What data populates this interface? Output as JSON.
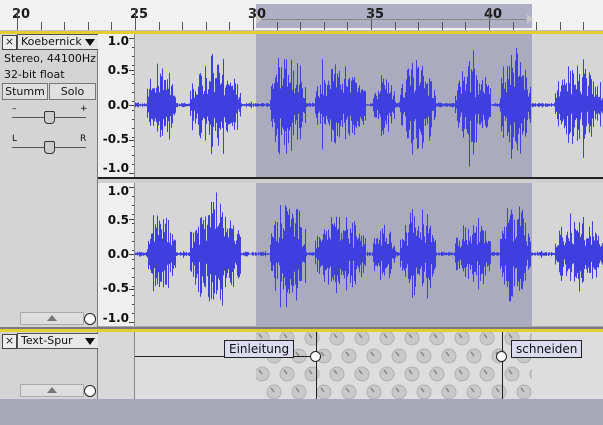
{
  "ruler": {
    "ticks": [
      "20",
      "25",
      "30",
      "35",
      "40"
    ]
  },
  "audio_track": {
    "name": "Koebernick",
    "info_format": "Stereo, 44100Hz",
    "info_bits": "32-bit float",
    "mute_label": "Stumm",
    "solo_label": "Solo",
    "gain_minus": "–",
    "gain_plus": "+",
    "pan_left": "L",
    "pan_right": "R",
    "scale_labels": [
      "1.0",
      "0.5",
      "0.0",
      "-0.5",
      "-1.0"
    ],
    "wave_color": "#3f3fdf"
  },
  "label_track": {
    "name": "Text-Spur",
    "labels": [
      "Einleitung",
      "schneiden"
    ]
  },
  "colors": {
    "selection": "#ababbf",
    "track_border": "#e4cf32",
    "background": "#d6d6d6"
  },
  "icons": {
    "close": "×",
    "dropdown": "chevron-down-icon",
    "sync": "clock-icon",
    "collapse": "triangle-up-icon"
  }
}
